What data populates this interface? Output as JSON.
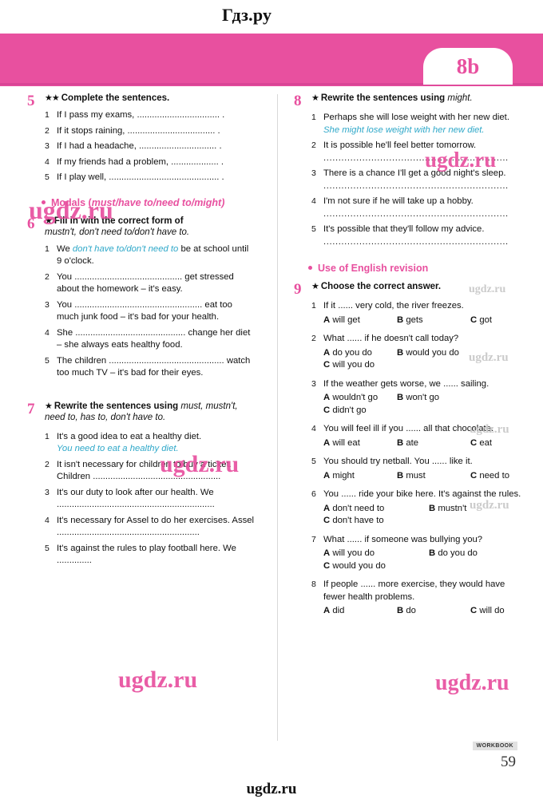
{
  "site": {
    "logo": "Гдз.ру",
    "footer_logo": "ugdz.ru",
    "watermark": "ugdz.ru"
  },
  "banner": {
    "unit": "8b"
  },
  "footer": {
    "workbook_label": "WORKBOOK",
    "page_number": "59"
  },
  "left_column": {
    "exercise5": {
      "number": "5",
      "stars": "★★",
      "title": "Complete the sentences.",
      "items": [
        {
          "n": "1",
          "text": "If I pass my exams,  ................................. ."
        },
        {
          "n": "2",
          "text": "If it stops raining,  ................................... ."
        },
        {
          "n": "3",
          "text": "If I had a headache, ............................... ."
        },
        {
          "n": "4",
          "text": "If my friends had a problem, ................... ."
        },
        {
          "n": "5",
          "text": "If I play well, ............................................ ."
        }
      ]
    },
    "modals_heading": {
      "plain": "Modals (",
      "italic": "must/have to/need to/might)"
    },
    "exercise6": {
      "number": "6",
      "stars": "★",
      "title_bold": "Fill in with the correct form of",
      "title_italic": "mustn't, don't need to/don't have to.",
      "items": [
        {
          "n": "1",
          "pre": "We ",
          "answer": "don't have to/don't need to",
          "post": " be at school until 9 o'clock."
        },
        {
          "n": "2",
          "pre": "You ........................................... get stressed about the homework – it's easy.",
          "answer": "",
          "post": ""
        },
        {
          "n": "3",
          "pre": "You ................................................... eat too much junk food – it's bad for your health.",
          "answer": "",
          "post": ""
        },
        {
          "n": "4",
          "pre": "She ............................................ change her diet – she always eats healthy food.",
          "answer": "",
          "post": ""
        },
        {
          "n": "5",
          "pre": "The children  .............................................. watch too much TV – it's bad for their eyes.",
          "answer": "",
          "post": ""
        }
      ]
    },
    "exercise7": {
      "number": "7",
      "stars": "★",
      "title_bold": "Rewrite the sentences using",
      "title_italic": "must, mustn't, need to, has to, don't have to.",
      "items": [
        {
          "n": "1",
          "text": "It's a good idea to eat a healthy diet.",
          "answer": "You need to eat a healthy diet."
        },
        {
          "n": "2",
          "text": "It isn't necessary for children to buy a ticket. Children ...................................................",
          "answer": ""
        },
        {
          "n": "3",
          "text": "It's our duty to look after our health. We ...............................................................",
          "answer": ""
        },
        {
          "n": "4",
          "text": "It's necessary for Assel to do her exercises. Assel .........................................................",
          "answer": ""
        },
        {
          "n": "5",
          "text": "It's against the rules to play football here. We ..............",
          "answer": ""
        }
      ]
    }
  },
  "right_column": {
    "exercise8": {
      "number": "8",
      "stars": "★",
      "title_bold": "Rewrite the sentences using",
      "title_italic": "might.",
      "items": [
        {
          "n": "1",
          "text": "Perhaps she will lose weight with her new diet.",
          "answer": "She might lose weight with her new diet."
        },
        {
          "n": "2",
          "text": "It is possible he'll feel better tomorrow.",
          "answer": ".............................................................."
        },
        {
          "n": "3",
          "text": "There is a chance I'll get a good night's sleep.",
          "answer": ".............................................................."
        },
        {
          "n": "4",
          "text": "I'm not sure if he will take up a hobby.",
          "answer": ".............................................................."
        },
        {
          "n": "5",
          "text": "It's possible that they'll follow my advice.",
          "answer": ".............................................................."
        }
      ]
    },
    "use_of_english_heading": "Use of English revision",
    "exercise9": {
      "number": "9",
      "stars": "★",
      "title": "Choose the correct answer.",
      "items": [
        {
          "n": "1",
          "question": "If it ...... very cold, the river freezes.",
          "options": [
            {
              "letter": "A",
              "text": "will get"
            },
            {
              "letter": "B",
              "text": "gets"
            },
            {
              "letter": "C",
              "text": "got"
            }
          ],
          "layout": "inline"
        },
        {
          "n": "2",
          "question": "What ...... if he doesn't call today?",
          "options": [
            {
              "letter": "A",
              "text": "do you do"
            },
            {
              "letter": "B",
              "text": "would you do"
            },
            {
              "letter": "C",
              "text": "will you do"
            }
          ],
          "layout": "two-one"
        },
        {
          "n": "3",
          "question": "If the weather gets worse, we ...... sailing.",
          "options": [
            {
              "letter": "A",
              "text": "wouldn't go"
            },
            {
              "letter": "B",
              "text": "won't go"
            },
            {
              "letter": "C",
              "text": "didn't go"
            }
          ],
          "layout": "two-one"
        },
        {
          "n": "4",
          "question": "You will feel ill if you ...... all that chocolate.",
          "options": [
            {
              "letter": "A",
              "text": "will eat"
            },
            {
              "letter": "B",
              "text": "ate"
            },
            {
              "letter": "C",
              "text": "eat"
            }
          ],
          "layout": "inline"
        },
        {
          "n": "5",
          "question": "You should try netball. You ...... like it.",
          "options": [
            {
              "letter": "A",
              "text": "might"
            },
            {
              "letter": "B",
              "text": "must"
            },
            {
              "letter": "C",
              "text": "need to"
            }
          ],
          "layout": "inline"
        },
        {
          "n": "6",
          "question": "You ...... ride your bike here. It's against the rules.",
          "options": [
            {
              "letter": "A",
              "text": "don't need to"
            },
            {
              "letter": "B",
              "text": "mustn't"
            },
            {
              "letter": "C",
              "text": "don't have to"
            }
          ],
          "layout": "two-one"
        },
        {
          "n": "7",
          "question": "What ...... if someone was bullying you?",
          "options": [
            {
              "letter": "A",
              "text": "will you do"
            },
            {
              "letter": "B",
              "text": "do you do"
            },
            {
              "letter": "C",
              "text": "would you do"
            }
          ],
          "layout": "two-one"
        },
        {
          "n": "8",
          "question": "If  people  ......  more  exercise,  they  would have fewer health problems.",
          "options": [
            {
              "letter": "A",
              "text": "did"
            },
            {
              "letter": "B",
              "text": "do"
            },
            {
              "letter": "C",
              "text": "will do"
            }
          ],
          "layout": "inline"
        }
      ]
    }
  }
}
